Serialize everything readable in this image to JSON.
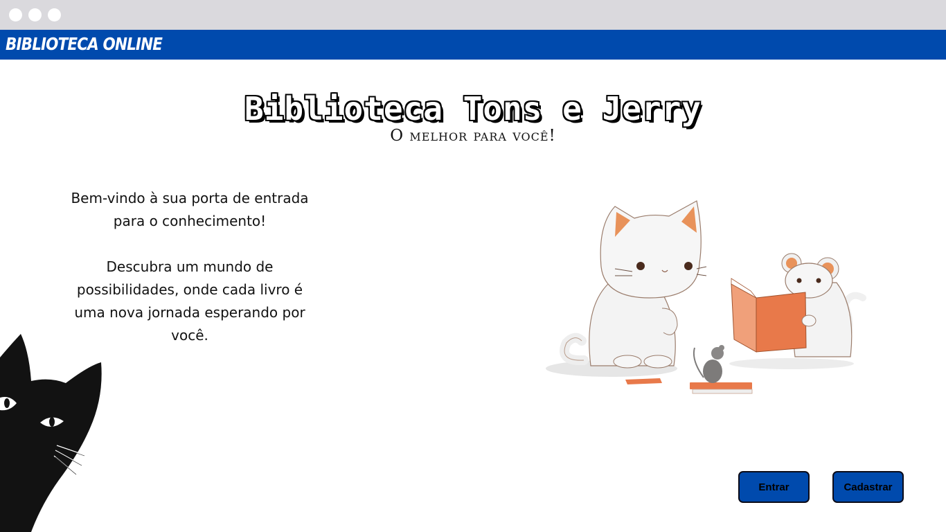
{
  "window": {
    "controls": [
      "window-dot",
      "window-dot",
      "window-dot"
    ]
  },
  "brand": {
    "name": "BIBLIOTECA ONLINE",
    "color": "#004aad"
  },
  "hero": {
    "title": "Biblioteca Tons e Jerry",
    "subtitle": "O melhor para você!"
  },
  "intro": {
    "paragraph1": "Bem-vindo à sua porta de entrada para o conhecimento!",
    "paragraph2": "Descubra um mundo de possibilidades, onde cada livro é uma nova jornada esperando por você."
  },
  "illustrations": {
    "main": "cat-and-mice-reading-illustration",
    "corner": "black-cat-peeking-illustration"
  },
  "actions": {
    "login_label": "Entrar",
    "register_label": "Cadastrar",
    "button_color": "#004aad"
  }
}
